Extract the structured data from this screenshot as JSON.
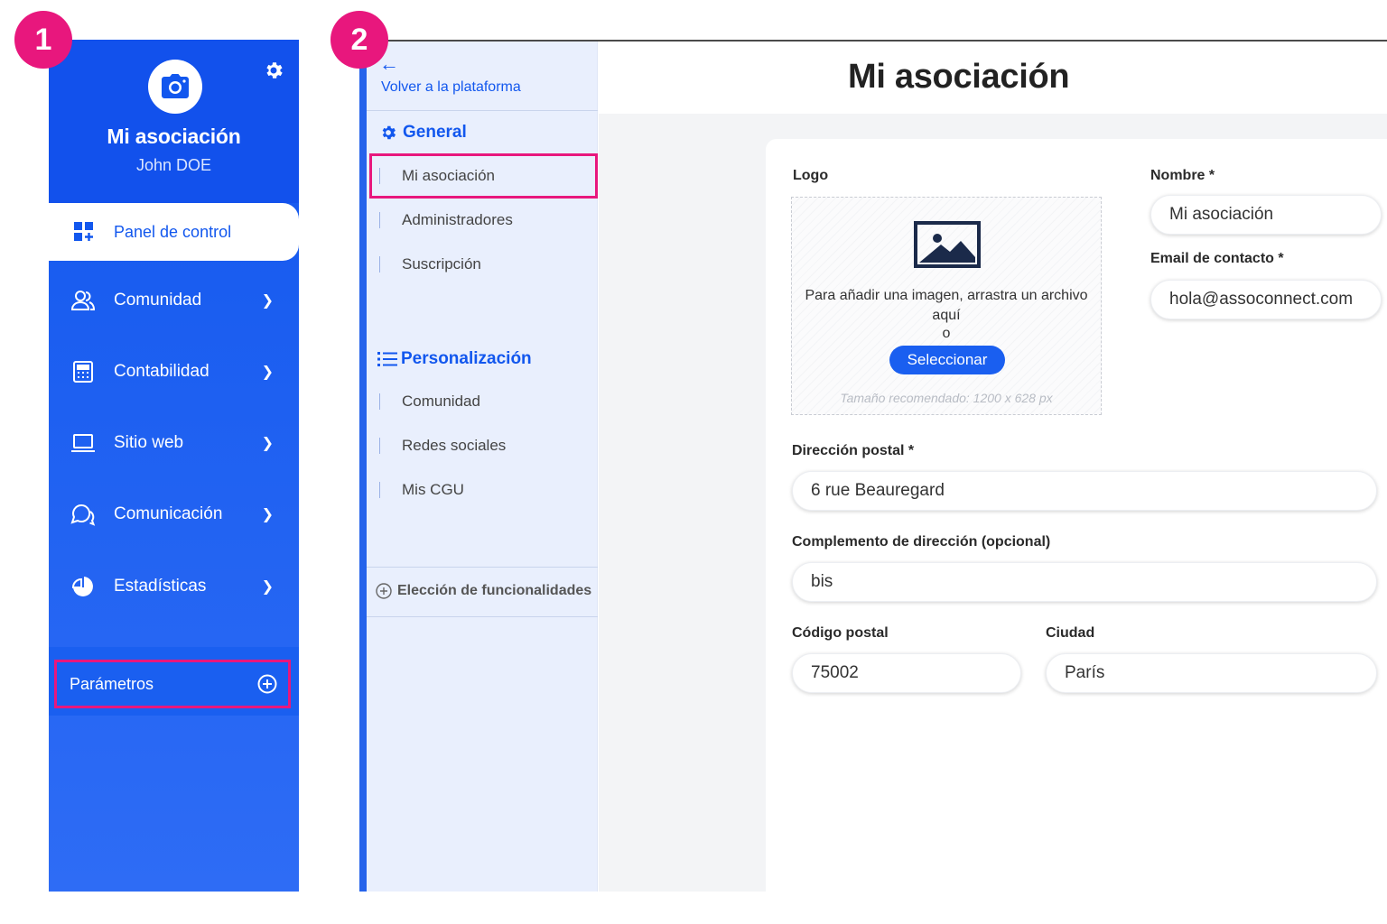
{
  "badges": {
    "step1": "1",
    "step2": "2"
  },
  "sidebar": {
    "org_name": "Mi asociación",
    "user_name": "John DOE",
    "dashboard_label": "Panel de control",
    "items": [
      {
        "label": "Comunidad",
        "icon": "users-icon"
      },
      {
        "label": "Contabilidad",
        "icon": "calculator-icon"
      },
      {
        "label": "Sitio web",
        "icon": "laptop-icon"
      },
      {
        "label": "Comunicación",
        "icon": "chat-icon"
      },
      {
        "label": "Estadísticas",
        "icon": "pie-chart-icon"
      }
    ],
    "params_label": "Parámetros"
  },
  "settings_menu": {
    "back_label": "Volver a la plataforma",
    "general_title": "General",
    "general_items": [
      "Mi asociación",
      "Administradores",
      "Suscripción"
    ],
    "personalization_title": "Personalización",
    "personalization_items": [
      "Comunidad",
      "Redes sociales",
      "Mis CGU"
    ],
    "features_label": "Elección de funcionalidades"
  },
  "page": {
    "title": "Mi asociación",
    "logo": {
      "label": "Logo",
      "hint": "Para añadir una imagen, arrastra un archivo aquí",
      "or": "o",
      "button": "Seleccionar",
      "size_hint": "Tamaño recomendado: 1200 x 628 px"
    },
    "name": {
      "label": "Nombre *",
      "value": "Mi asociación"
    },
    "email": {
      "label": "Email de contacto *",
      "value": "hola@assoconnect.com"
    },
    "address": {
      "label": "Dirección postal *",
      "value": "6 rue Beauregard"
    },
    "address2": {
      "label": "Complemento de dirección (opcional)",
      "value": "bis"
    },
    "postal": {
      "label": "Código postal",
      "value": "75002"
    },
    "city": {
      "label": "Ciudad",
      "value": "París"
    }
  },
  "colors": {
    "primary": "#1257ee",
    "highlight": "#e8177d",
    "menu_bg": "#e9effd",
    "page_bg": "#f3f4f6"
  }
}
